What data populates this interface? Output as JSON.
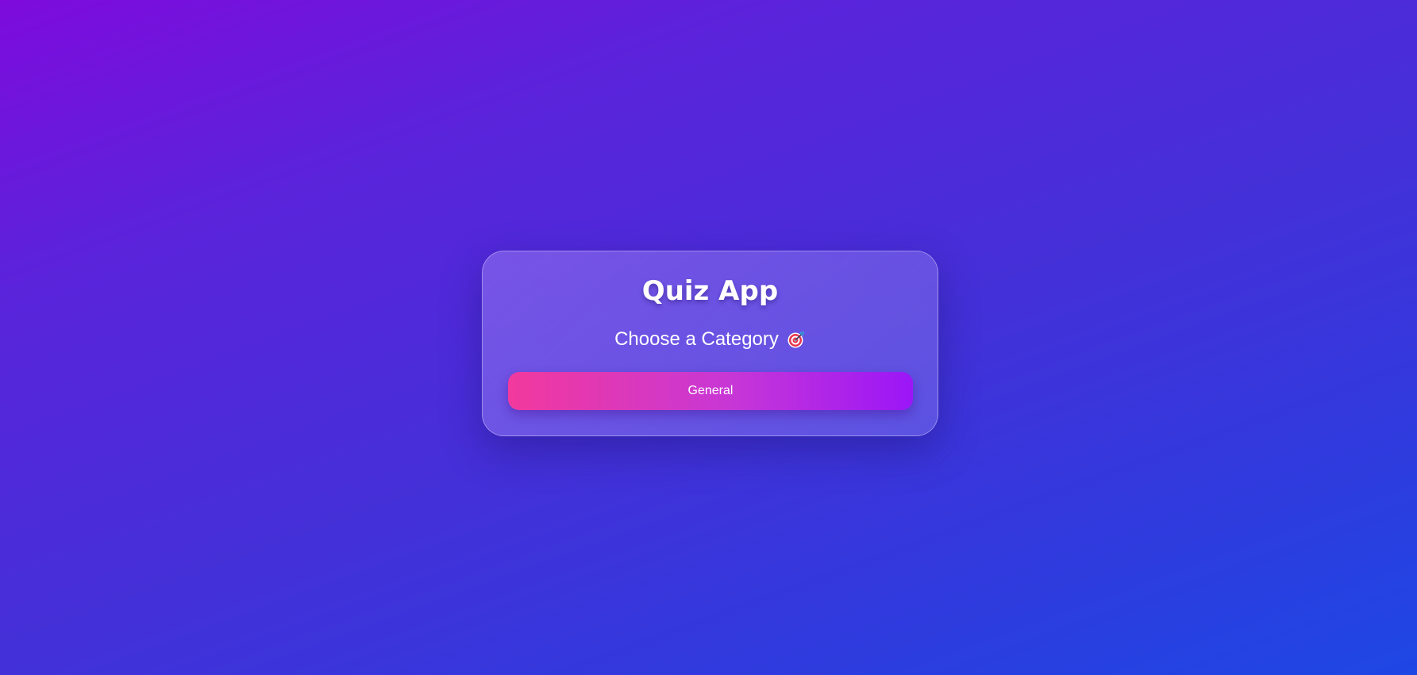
{
  "app": {
    "title": "Quiz App",
    "subtitle": "Choose a Category",
    "subtitle_icon": "target-icon"
  },
  "categories": [
    {
      "label": "General"
    }
  ],
  "colors": {
    "background_start": "#7e0bdc",
    "background_end": "#1e47e4",
    "button_gradient_start": "#f2399d",
    "button_gradient_end": "#9b16f7",
    "text": "#ffffff"
  }
}
